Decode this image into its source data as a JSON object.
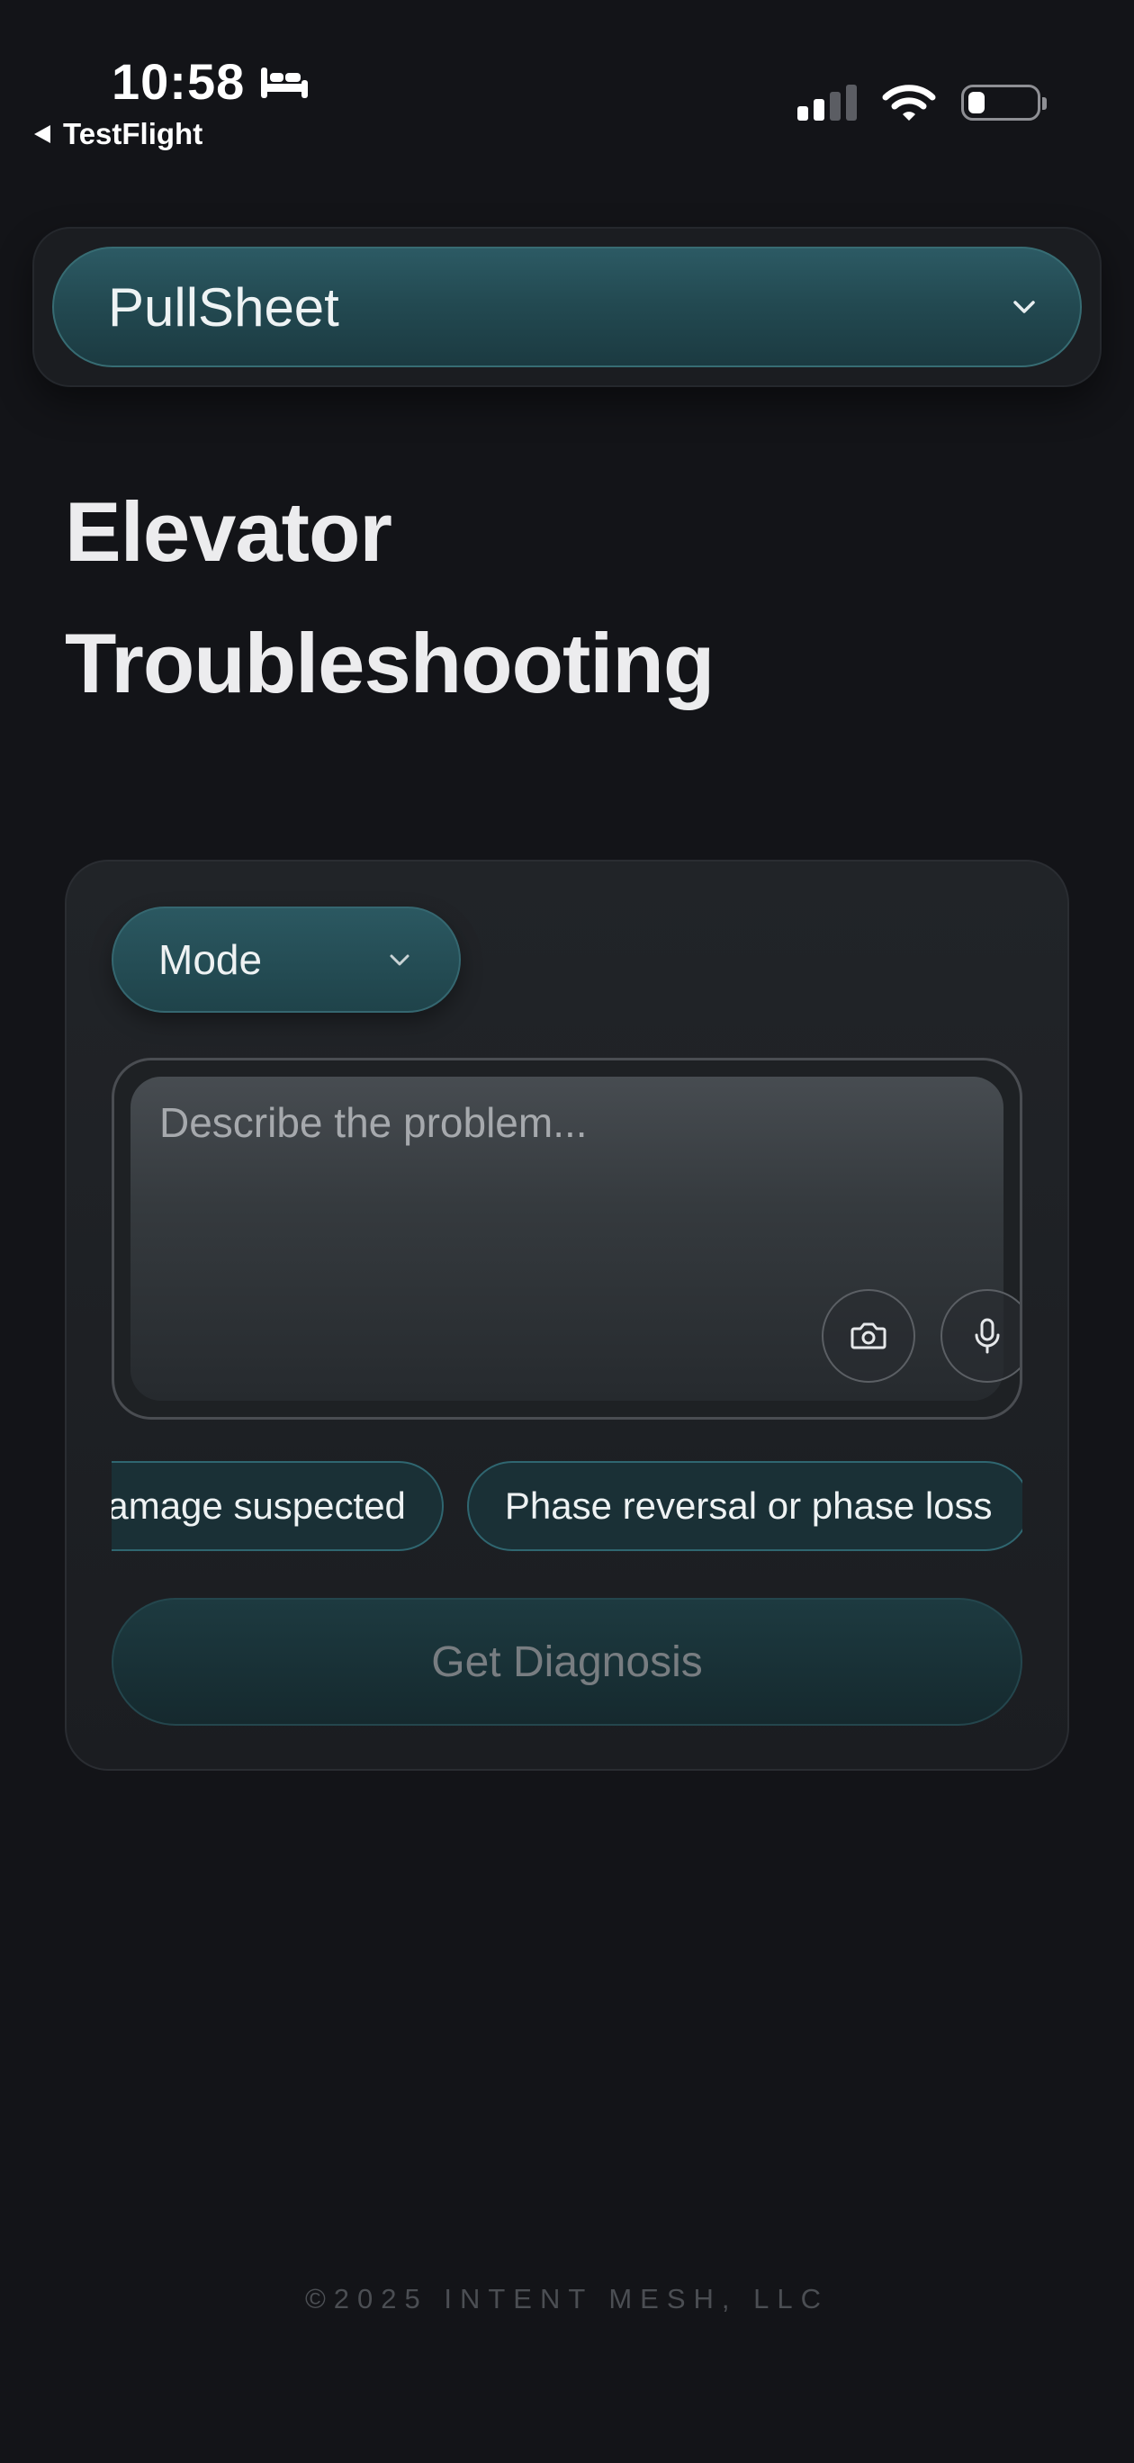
{
  "status_bar": {
    "time": "10:58",
    "back_app": "TestFlight",
    "icons": [
      "bed-icon",
      "signal-icon",
      "wifi-icon",
      "battery-icon"
    ]
  },
  "project": {
    "selected": "PullSheet"
  },
  "title": {
    "line1": "Elevator",
    "line2": "Troubleshooting"
  },
  "card": {
    "mode_label": "Mode",
    "input": {
      "value": "",
      "placeholder": "Describe the problem..."
    },
    "chips": [
      "damage suspected",
      "Phase reversal or phase loss"
    ],
    "diagnose_label": "Get Diagnosis"
  },
  "footer": {
    "copyright": "©2025 INTENT MESH, LLC"
  },
  "colors": {
    "background": "#131418",
    "accent": "#2a5760",
    "chip_border": "#2f6670"
  }
}
